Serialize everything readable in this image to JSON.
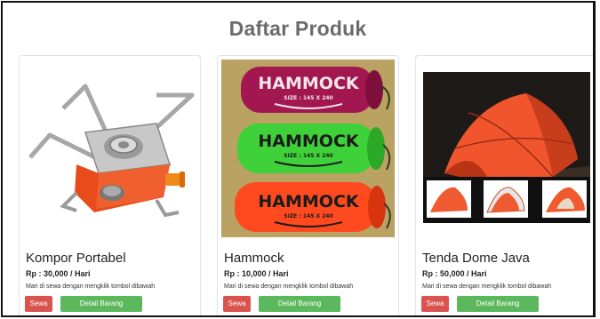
{
  "page": {
    "title": "Daftar Produk"
  },
  "products": [
    {
      "name": "Kompor Portabel",
      "price": "Rp : 30,000 / Hari",
      "description": "Mari di sewa dengan mengklik tombol dibawah",
      "rent_label": "Sewa",
      "detail_label": "Detail Barang"
    },
    {
      "name": "Hammock",
      "price": "Rp : 10,000 / Hari",
      "description": "Mari di sewa dengan mengklik tombol dibawah",
      "rent_label": "Sewa",
      "detail_label": "Detail Barang",
      "image_text": "HAMMOCK",
      "image_subtext": "SIZE : 145 X 240"
    },
    {
      "name": "Tenda Dome Java",
      "price": "Rp : 50,000 / Hari",
      "description": "Mari di sewa dengan mengklik tombol dibawah",
      "rent_label": "Sewa",
      "detail_label": "Detail Barang"
    }
  ],
  "colors": {
    "rent_button": "#d9534f",
    "detail_button": "#5cb85c",
    "title": "#6b6b6b"
  }
}
